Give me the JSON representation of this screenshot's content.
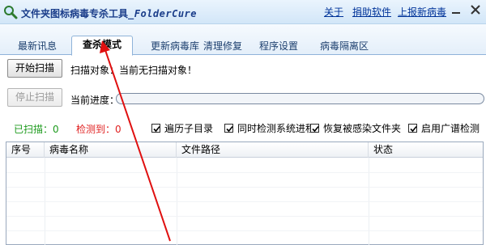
{
  "window": {
    "title_cn": "文件夹图标病毒专杀工具",
    "title_en": "_FolderCure",
    "links": [
      "关于",
      "捐助软件",
      "上报新病毒"
    ]
  },
  "tabs": [
    {
      "label": "最新讯息",
      "active": false
    },
    {
      "label": "查杀模式",
      "active": true
    },
    {
      "label": "更新病毒库",
      "active": false
    },
    {
      "label": "清理修复",
      "active": false
    },
    {
      "label": "程序设置",
      "active": false
    },
    {
      "label": "病毒隔离区",
      "active": false
    }
  ],
  "scan": {
    "start_button": "开始扫描",
    "target_label": "扫描对象：",
    "target_value": "当前无扫描对象！",
    "stop_button": "停止扫描",
    "progress_label": "当前进度：",
    "progress_percent": 0
  },
  "status": {
    "scanned_label": "已扫描：",
    "scanned_value": "0",
    "detected_label": "检测到：",
    "detected_value": "0",
    "scanned_color": "#1c9a1c",
    "detected_color": "#e02020"
  },
  "options": [
    {
      "label": "遍历子目录",
      "checked": true
    },
    {
      "label": "同时检测系统进程",
      "checked": true
    },
    {
      "label": "恢复被感染文件夹",
      "checked": true
    },
    {
      "label": "启用广谱检测",
      "checked": true
    }
  ],
  "table": {
    "columns": [
      "序号",
      "病毒名称",
      "文件路径",
      "状态"
    ],
    "rows": []
  },
  "colors": {
    "accent": "#1a3d8a",
    "link": "#003399",
    "arrow": "#e01010"
  }
}
